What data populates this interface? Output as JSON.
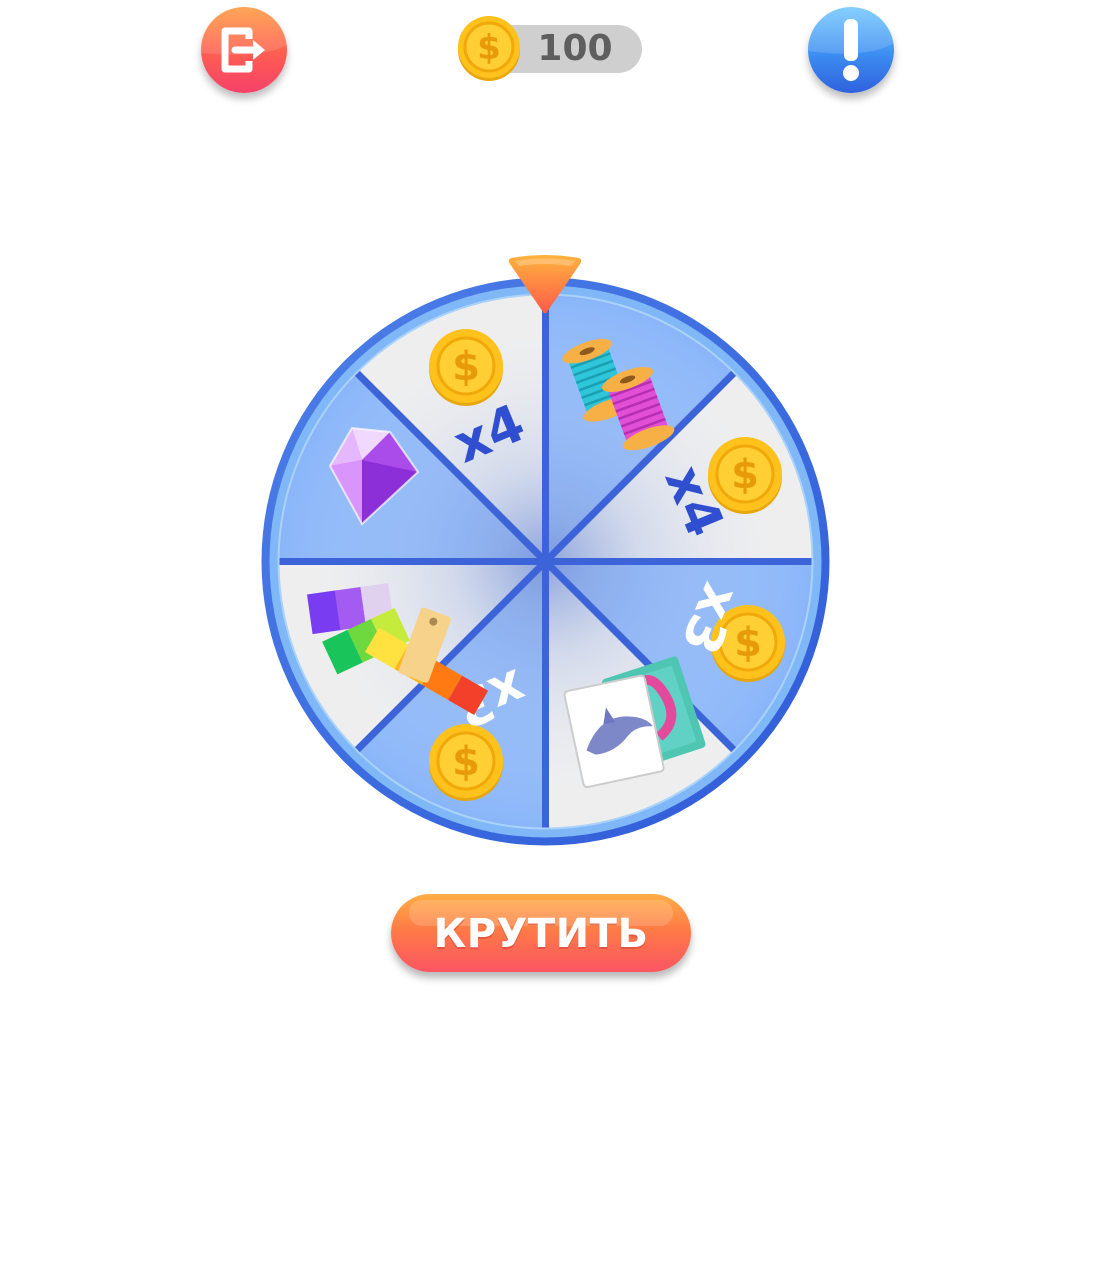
{
  "header": {
    "exit_icon": "exit-icon",
    "info_icon": "exclamation-icon",
    "coins": "100",
    "coin_icon": "dollar-coin-icon"
  },
  "wheel": {
    "pointer_icon": "triangle-pointer-icon",
    "segments": [
      {
        "reward": "thread-spools",
        "icon": "thread-spools-icon"
      },
      {
        "reward": "coins",
        "multiplier": "x4",
        "icon": "dollar-coin-icon"
      },
      {
        "reward": "coins",
        "multiplier": "x3",
        "icon": "dollar-coin-icon"
      },
      {
        "reward": "picture-cards",
        "icon": "picture-cards-icon"
      },
      {
        "reward": "coins",
        "multiplier": "x3",
        "icon": "dollar-coin-icon"
      },
      {
        "reward": "color-palette",
        "icon": "color-palette-icon"
      },
      {
        "reward": "gem",
        "icon": "gem-icon"
      },
      {
        "reward": "coins",
        "multiplier": "x4",
        "icon": "dollar-coin-icon"
      }
    ]
  },
  "spin_button": {
    "label": "КРУТИТЬ"
  },
  "colors": {
    "segment_blue": "#8ab6f9",
    "segment_grey": "#eeeeee",
    "rim_blue": "#3e6fe3",
    "multiplier_dark": "#2f4fd0",
    "multiplier_light": "#ffffff",
    "coin_gold": "#ffc21d"
  }
}
